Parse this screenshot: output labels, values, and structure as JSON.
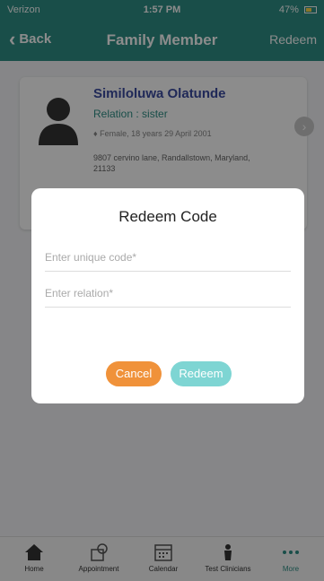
{
  "status": {
    "carrier": "Verizon",
    "time": "1:57 PM",
    "battery": "47%"
  },
  "nav": {
    "back_label": "Back",
    "title": "Family Member",
    "action_label": "Redeem"
  },
  "member": {
    "name": "Similoluwa Olatunde",
    "relation": "Relation : sister",
    "meta": "Female, 18 years 29 April 2001",
    "address": "9807 cervino lane, Randallstown, Maryland, 21133"
  },
  "dialog": {
    "title": "Redeem Code",
    "code_placeholder": "Enter unique code*",
    "relation_placeholder": "Enter relation*",
    "cancel_label": "Cancel",
    "redeem_label": "Redeem"
  },
  "tabs": [
    {
      "label": "Home",
      "icon": "home-icon"
    },
    {
      "label": "Appointment",
      "icon": "appointment-icon"
    },
    {
      "label": "Calendar",
      "icon": "calendar-icon"
    },
    {
      "label": "Test Clinicians",
      "icon": "clinician-icon"
    },
    {
      "label": "More",
      "icon": "more-icon"
    }
  ],
  "colors": {
    "primary": "#2f8f86",
    "cancel": "#f0923a",
    "redeem": "#7ed5d3"
  }
}
